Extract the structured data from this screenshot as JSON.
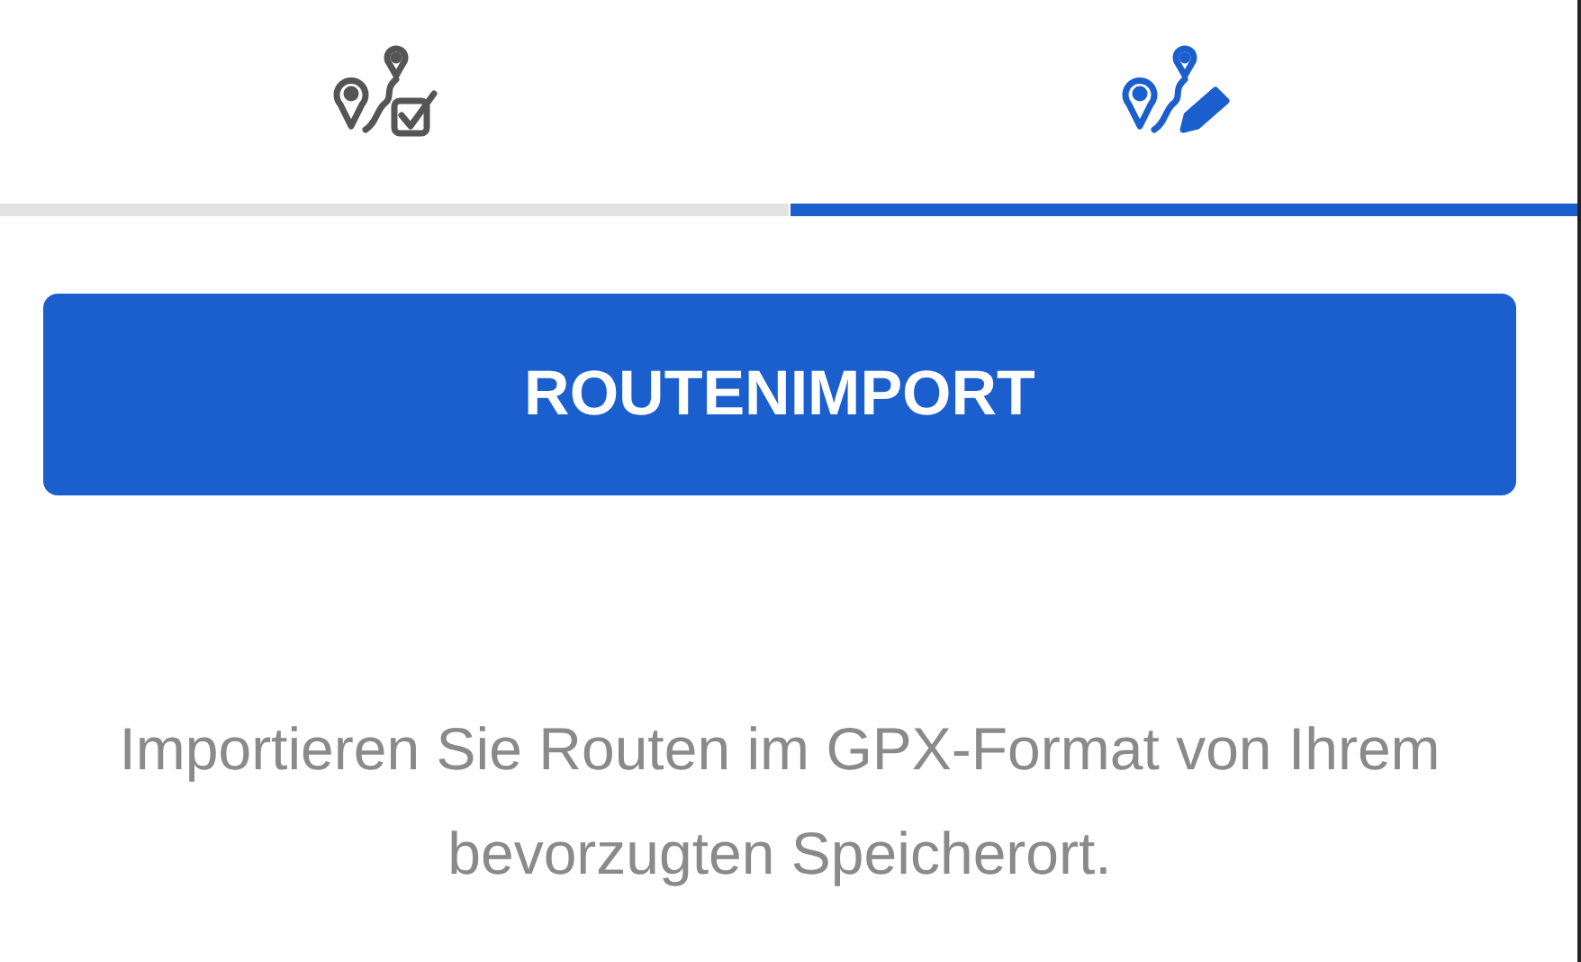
{
  "tabs": [
    {
      "kind": "route-check",
      "selected": false
    },
    {
      "kind": "route-edit",
      "selected": true
    }
  ],
  "import_button": {
    "label": "ROUTENIMPORT"
  },
  "description": "Importieren Sie Routen im GPX-Format von Ihrem bevorzugten Speicherort."
}
